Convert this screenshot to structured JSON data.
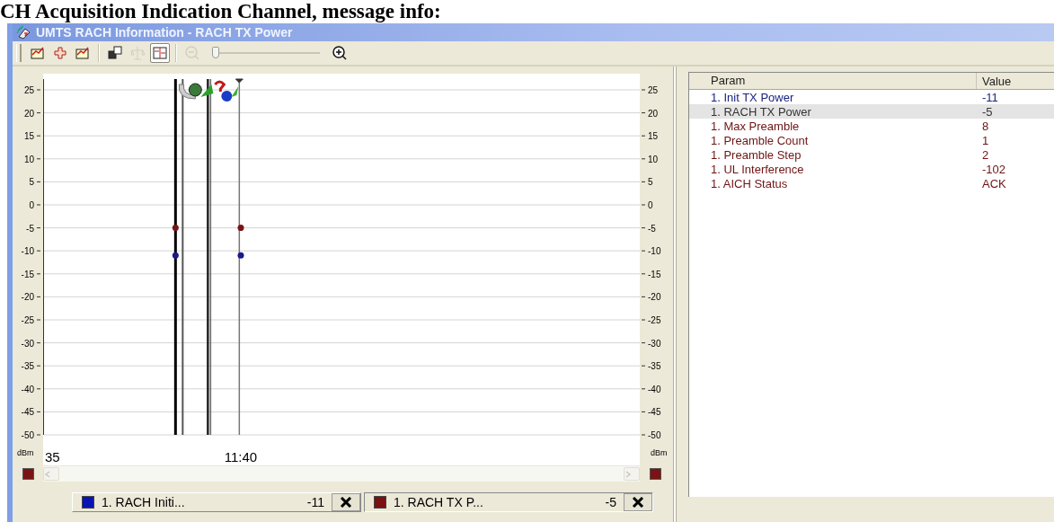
{
  "heading": "CH Acquisition Indication Channel, message info:",
  "window": {
    "title": "UMTS RACH Information - RACH TX Power"
  },
  "toolbar": {
    "tools": [
      {
        "kind": "chart",
        "pressed": false,
        "disabled": false
      },
      {
        "kind": "puzzle",
        "pressed": false,
        "disabled": false
      },
      {
        "kind": "chart",
        "pressed": false,
        "disabled": false
      },
      {
        "kind": "windows",
        "pressed": false,
        "disabled": false
      },
      {
        "kind": "scale",
        "pressed": false,
        "disabled": true
      },
      {
        "kind": "layout",
        "pressed": true,
        "disabled": false
      },
      {
        "kind": "zoomout",
        "pressed": false,
        "disabled": true
      }
    ],
    "zoom_slider": {
      "level": 0
    },
    "zoom_in": {
      "disabled": false
    }
  },
  "chart": {
    "unit_left": "dBm",
    "unit_right": "dBm",
    "right_axis_labels": [
      "25",
      "20",
      "15",
      "10",
      "5",
      "0",
      "-5",
      "-10",
      "-15",
      "-20",
      "-25",
      "-30",
      "-35",
      "-40",
      "-45",
      "-50"
    ],
    "chart_data": {
      "type": "scatter",
      "grid": true,
      "ylim": [
        -50,
        25
      ],
      "yticks": [
        25,
        20,
        15,
        10,
        5,
        0,
        -5,
        -10,
        -15,
        -20,
        -25,
        -30,
        -35,
        -40,
        -45,
        -50
      ],
      "categories": [
        "35",
        null,
        null,
        "11:40"
      ],
      "series": [
        {
          "name": "1. RACH Initi...",
          "color": "#1a1a8c",
          "values": [
            null,
            null,
            -11,
            -11
          ]
        },
        {
          "name": "1. RACH TX P...",
          "color": "#7a1414",
          "values": [
            null,
            null,
            -5,
            -5
          ]
        }
      ]
    }
  },
  "legend": [
    {
      "value": "-11",
      "color": "#0a14b4",
      "selected": false
    },
    {
      "value": "-5",
      "color": "#7a1010",
      "selected": true
    }
  ],
  "table": {
    "columns": [
      "Param",
      "Value"
    ],
    "rows": [
      {
        "cells": [
          "1. Init TX Power",
          "-11"
        ],
        "color": "#1a237e",
        "selected": false
      },
      {
        "cells": [
          "1. RACH TX Power",
          "-5"
        ],
        "color": "#333333",
        "selected": true
      },
      {
        "cells": [
          "1. Max Preamble",
          "8"
        ],
        "color": "#6e1414",
        "selected": false
      },
      {
        "cells": [
          "1. Preamble Count",
          "1"
        ],
        "color": "#6e1414",
        "selected": false
      },
      {
        "cells": [
          "1. Preamble Step",
          "2"
        ],
        "color": "#6e1414",
        "selected": false
      },
      {
        "cells": [
          "1. UL Interference",
          "-102"
        ],
        "color": "#6e1414",
        "selected": false
      },
      {
        "cells": [
          "1. AICH Status",
          "ACK"
        ],
        "color": "#6e1414",
        "selected": false
      }
    ]
  }
}
